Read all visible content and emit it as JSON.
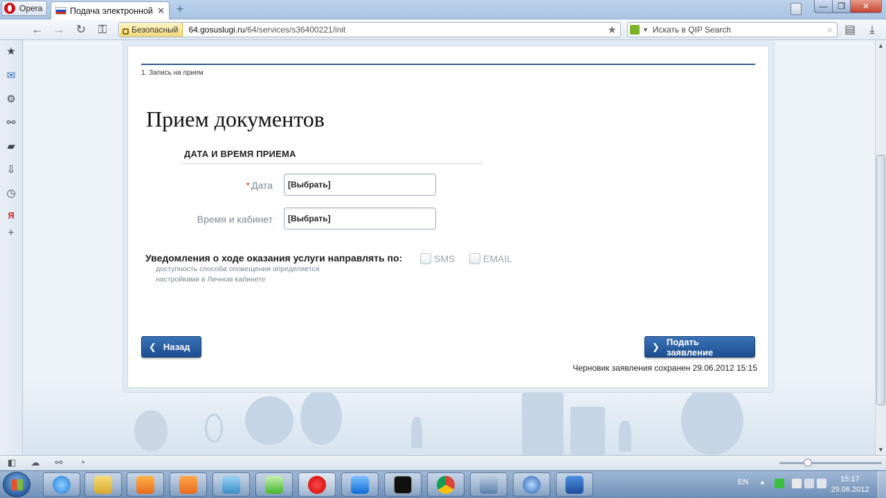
{
  "browser": {
    "menu_label": "Opera",
    "tab_title": "Подача электронной ...",
    "tab_close": "✕",
    "new_tab": "+",
    "security_label": "Безопасный",
    "url_host": "64.gosuslugi.ru",
    "url_path": "/64/services/s36400221/init",
    "search_placeholder": "Искать в QIP Search"
  },
  "page": {
    "step_label": "1. Запись на прием",
    "title": "Прием документов",
    "section_title": "ДАТА И ВРЕМЯ ПРИЕМА",
    "fields": {
      "date": {
        "label": "Дата",
        "required_mark": "*",
        "value": "[Выбрать]"
      },
      "time_room": {
        "label": "Время и кабинет",
        "value": "[Выбрать]"
      }
    },
    "notifications": {
      "title": "Уведомления о ходе оказания услуги направлять по:",
      "note_line1": "доступность способа оповещения определяется",
      "note_line2": "настройками в Личном кабинете",
      "sms_label": "SMS",
      "sms_checked": false,
      "email_label": "EMAIL",
      "email_checked": false
    },
    "back_button": "Назад",
    "submit_button": "Подать заявление",
    "saved_text": "Черновик заявления сохранен 29.06.2012 15:15"
  },
  "taskbar": {
    "language": "EN",
    "time": "15:17",
    "date": "29.06.2012"
  },
  "icons": {
    "sidebar": [
      "bookmarks-icon",
      "mail-icon",
      "settings-icon",
      "unite-icon",
      "notes-icon",
      "downloads-icon",
      "history-icon",
      "yandex-icon",
      "add-panel-icon"
    ]
  },
  "colors": {
    "primary_button": "#1d4e8f",
    "header_rule": "#2b5a8c",
    "required": "#dd3333"
  }
}
